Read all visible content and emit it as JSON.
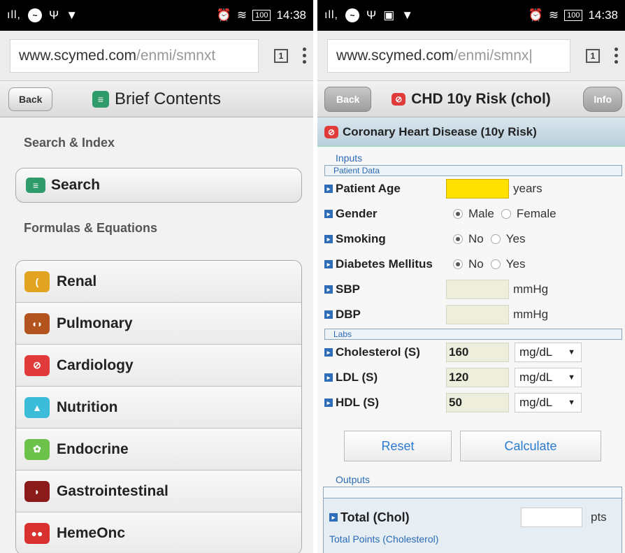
{
  "left": {
    "status": {
      "time": "14:38",
      "battery": "100"
    },
    "url": {
      "domain": "www.scymed.com",
      "path": "/enmi/smnxt",
      "tab_count": "1"
    },
    "header": {
      "back_label": "Back",
      "title": "Brief Contents"
    },
    "search_section": {
      "label": "Search & Index",
      "search_label": "Search"
    },
    "formulas_section": {
      "label": "Formulas & Equations"
    },
    "items": [
      {
        "label": "Renal",
        "color": "#e2a320",
        "icon": "kidney-icon"
      },
      {
        "label": "Pulmonary",
        "color": "#b3541e",
        "icon": "lungs-icon"
      },
      {
        "label": "Cardiology",
        "color": "#e03a3a",
        "icon": "heart-icon"
      },
      {
        "label": "Nutrition",
        "color": "#3bbdd9",
        "icon": "nutrition-icon"
      },
      {
        "label": "Endocrine",
        "color": "#6cc24a",
        "icon": "endocrine-icon"
      },
      {
        "label": "Gastrointestinal",
        "color": "#8b1a1a",
        "icon": "stomach-icon"
      },
      {
        "label": "HemeOnc",
        "color": "#d93030",
        "icon": "blood-cells-icon"
      }
    ]
  },
  "right": {
    "status": {
      "time": "14:38",
      "battery": "100"
    },
    "url": {
      "domain": "www.scymed.com",
      "path": "/enmi/smnx|",
      "tab_count": "1"
    },
    "header": {
      "back_label": "Back",
      "title": "CHD 10y Risk (chol)",
      "info_label": "Info"
    },
    "subheader": "Coronary Heart Disease (10y Risk)",
    "inputs_label": "Inputs",
    "patient_group": "Patient Data",
    "age": {
      "label": "Patient Age",
      "value": "",
      "unit": "years"
    },
    "gender": {
      "label": "Gender",
      "opt1": "Male",
      "opt2": "Female",
      "selected": "Male"
    },
    "smoking": {
      "label": "Smoking",
      "opt1": "No",
      "opt2": "Yes",
      "selected": "No"
    },
    "diabetes": {
      "label": "Diabetes Mellitus",
      "opt1": "No",
      "opt2": "Yes",
      "selected": "No"
    },
    "sbp": {
      "label": "SBP",
      "value": "",
      "unit": "mmHg"
    },
    "dbp": {
      "label": "DBP",
      "value": "",
      "unit": "mmHg"
    },
    "labs_group": "Labs",
    "cholesterol": {
      "label": "Cholesterol (S)",
      "value": "160",
      "unit": "mg/dL"
    },
    "ldl": {
      "label": "LDL (S)",
      "value": "120",
      "unit": "mg/dL"
    },
    "hdl": {
      "label": "HDL (S)",
      "value": "50",
      "unit": "mg/dL"
    },
    "reset_label": "Reset",
    "calculate_label": "Calculate",
    "outputs_label": "Outputs",
    "total": {
      "label": "Total (Chol)",
      "value": "",
      "unit": "pts",
      "desc": "Total Points (Cholesterol)"
    }
  }
}
